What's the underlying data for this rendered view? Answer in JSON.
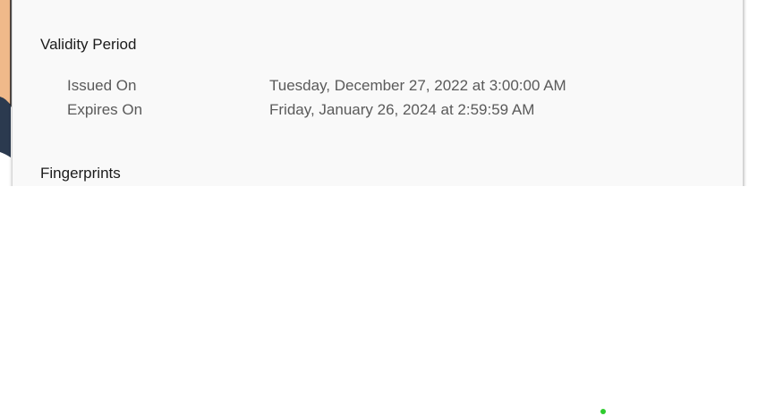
{
  "validity": {
    "heading": "Validity Period",
    "issued_label": "Issued On",
    "issued_value": "Tuesday, December 27, 2022 at 3:00:00 AM",
    "expires_label": "Expires On",
    "expires_value": "Friday, January 26, 2024 at 2:59:59 AM"
  },
  "fingerprints": {
    "heading": "Fingerprints"
  },
  "colors": {
    "panel_background": "#f9f9f9",
    "avatar_skin": "#f0b98a",
    "avatar_clothing": "#2b3a4f",
    "status_dot": "#2ecc2e"
  },
  "icons": {
    "avatar": "avatar-illustration",
    "status": "status-dot-icon"
  }
}
